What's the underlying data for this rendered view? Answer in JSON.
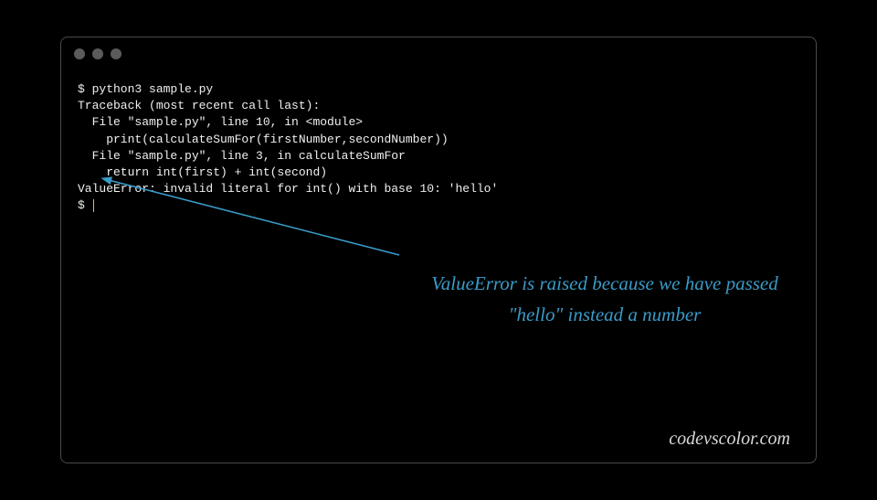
{
  "terminal": {
    "lines": [
      "$ python3 sample.py",
      "Traceback (most recent call last):",
      "  File \"sample.py\", line 10, in <module>",
      "    print(calculateSumFor(firstNumber,secondNumber))",
      "  File \"sample.py\", line 3, in calculateSumFor",
      "    return int(first) + int(second)",
      "ValueError: invalid literal for int() with base 10: 'hello'",
      "$ "
    ],
    "prompt": "$ "
  },
  "annotation": {
    "line1": "ValueError is raised because we have passed",
    "line2": "\"hello\" instead a number"
  },
  "watermark": "codevscolor.com",
  "colors": {
    "annotation": "#3a9bc8",
    "terminalText": "#f0f0f0",
    "border": "#4a4a4a"
  }
}
